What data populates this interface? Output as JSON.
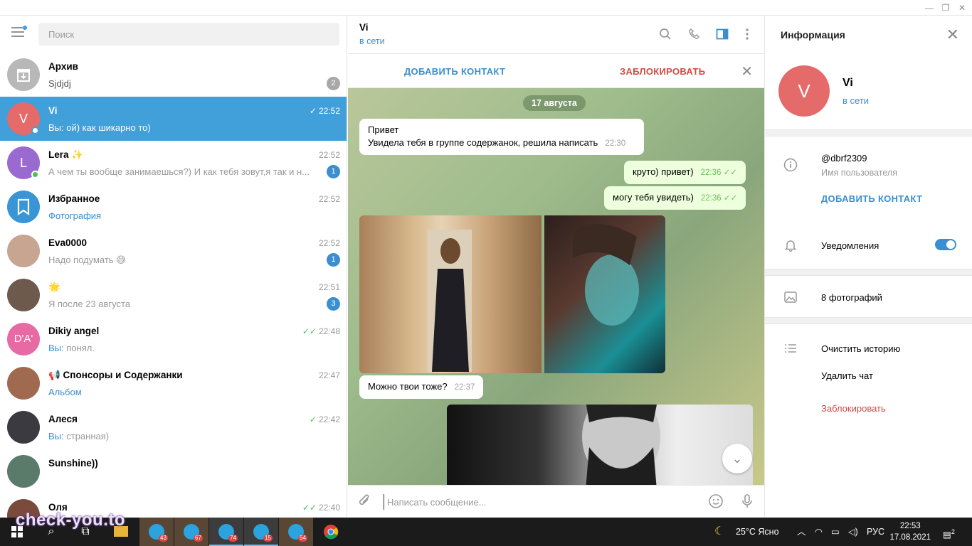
{
  "window": {
    "controls": [
      "—",
      "❐",
      "✕"
    ]
  },
  "left": {
    "search_placeholder": "Поиск",
    "chats": [
      {
        "name": "Архив",
        "msg": "Sjdjdj",
        "time": "",
        "badge": "2",
        "avatar_letter": "",
        "avatar_color": "#b8b8b8"
      },
      {
        "name": "Vi",
        "msg_prefix": "Вы:",
        "msg": " ой) как шикарно то)",
        "time": "22:52",
        "check": "✓",
        "avatar_letter": "V",
        "avatar_color": "#e56a6a"
      },
      {
        "name": "Lera ✨",
        "msg": "А чем ты вообще занимаешься?)   И как тебя зовут,я так и н...",
        "time": "22:52",
        "badge": "1",
        "avatar_letter": "L",
        "avatar_color": "#9b6ad1"
      },
      {
        "name": "Избранное",
        "msg": "Фотография",
        "time": "22:52",
        "avatar_letter": "",
        "avatar_color": "#3a95d6"
      },
      {
        "name": "Eva0000",
        "msg": "Надо подумать 😅",
        "time": "22:52",
        "badge": "1",
        "avatar_letter": "",
        "avatar_color": "#c7a590"
      },
      {
        "name": "🌟",
        "msg": "Я после 23 августа",
        "time": "22:51",
        "badge": "3",
        "avatar_letter": "",
        "avatar_color": "#6e5a4c"
      },
      {
        "name": "Dikiy angel",
        "msg_prefix": "Вы:",
        "msg": " понял.",
        "time": "22:48",
        "check": "✓✓",
        "avatar_letter": "D'A'",
        "avatar_color": "#e86aa5"
      },
      {
        "name": "📢 Спонсоры и Содержанки",
        "msg": "Альбом",
        "time": "22:47",
        "avatar_letter": "",
        "avatar_color": "#a06a50"
      },
      {
        "name": "Алеся",
        "msg_prefix": "Вы:",
        "msg": " странная)",
        "time": "22:42",
        "check": "✓",
        "avatar_letter": "",
        "avatar_color": "#3a3a40"
      },
      {
        "name": "Sunshine))",
        "msg": "",
        "time": "",
        "avatar_letter": "",
        "avatar_color": "#5a7a6a"
      },
      {
        "name": "Оля",
        "msg": "",
        "time": "22:40",
        "check": "✓✓",
        "avatar_letter": "",
        "avatar_color": "#7a4a3a"
      }
    ]
  },
  "center": {
    "peer_name": "Vi",
    "peer_status": "в сети",
    "add_contact": "ДОБАВИТЬ КОНТАКТ",
    "block": "ЗАБЛОКИРОВАТЬ",
    "date": "17 августа",
    "messages": [
      {
        "dir": "in",
        "text1": "Привет",
        "text2": "Увидела тебя в группе содержанок, решила написать",
        "time": "22:30"
      },
      {
        "dir": "out",
        "text1": "круто) привет)",
        "time": "22:36"
      },
      {
        "dir": "out",
        "text1": "могу тебя увидеть)",
        "time": "22:36"
      },
      {
        "dir": "in",
        "text1": "Можно твои тоже?",
        "time": "22:37"
      }
    ],
    "composer_placeholder": "Написать сообщение..."
  },
  "right": {
    "title": "Информация",
    "avatar_letter": "V",
    "name": "Vi",
    "status": "в сети",
    "username": "@dbrf2309",
    "username_label": "Имя пользователя",
    "add_contact": "ДОБАВИТЬ КОНТАКТ",
    "notifications": "Уведомления",
    "photos": "8 фотографий",
    "clear_history": "Очистить историю",
    "delete_chat": "Удалить чат",
    "block": "Заблокировать"
  },
  "taskbar": {
    "badges": [
      "43",
      "67",
      "74",
      "15",
      "54"
    ],
    "weather": "25°C  Ясно",
    "lang": "РУС",
    "time": "22:53",
    "date": "17.08.2021",
    "notif": "2"
  },
  "watermark": "check-you.to"
}
